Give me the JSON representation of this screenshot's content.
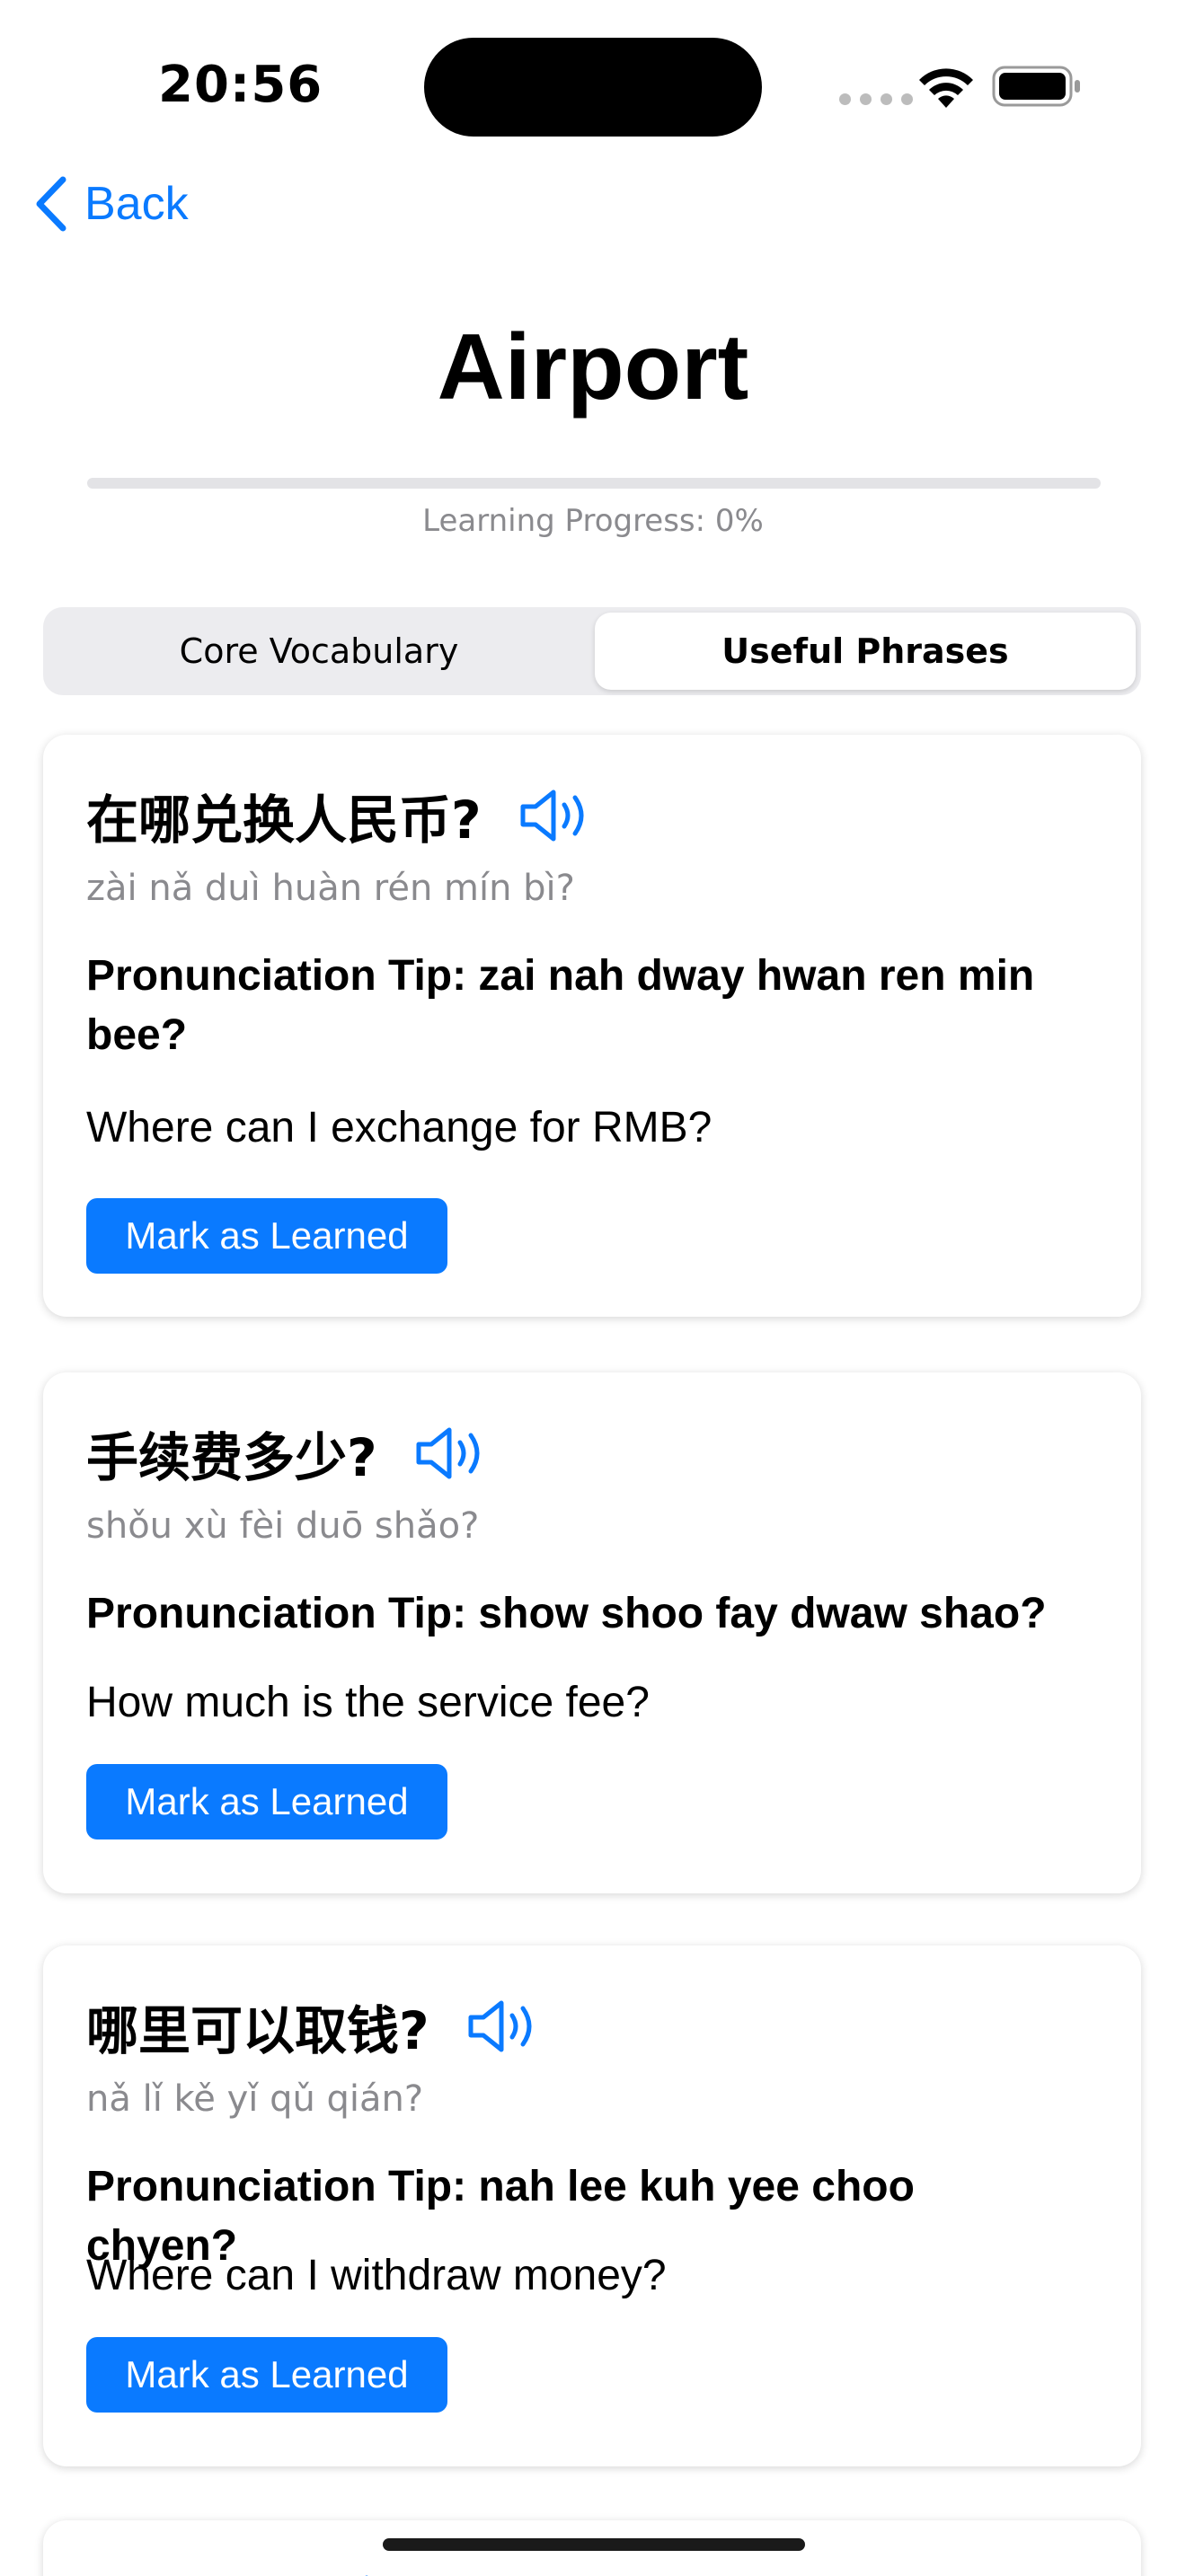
{
  "status_bar": {
    "time": "20:56"
  },
  "nav": {
    "back_label": "Back"
  },
  "page": {
    "title": "Airport",
    "progress_label": "Learning Progress: 0%",
    "progress_percent": 0
  },
  "tabs": [
    {
      "label": "Core Vocabulary",
      "selected": false
    },
    {
      "label": "Useful Phrases",
      "selected": true
    }
  ],
  "phrases": [
    {
      "hanzi": "在哪兑换人民币?",
      "pinyin": "zài nǎ duì huàn rén mín bì?",
      "tip": "Pronunciation Tip: zai nah dway hwan ren min bee?",
      "meaning": "Where can I exchange for RMB?",
      "button": "Mark as Learned"
    },
    {
      "hanzi": "手续费多少?",
      "pinyin": "shǒu xù fèi duō shǎo?",
      "tip": "Pronunciation Tip: show shoo fay dwaw shao?",
      "meaning": "How much is the service fee?",
      "button": "Mark as Learned"
    },
    {
      "hanzi": "哪里可以取钱?",
      "pinyin": "nǎ lǐ kě yǐ qǔ qián?",
      "tip": "Pronunciation Tip: nah lee kuh yee choo chyen?",
      "meaning": "Where can I withdraw money?",
      "button": "Mark as Learned"
    },
    {
      "hanzi": "帮我注册"
    }
  ],
  "colors": {
    "accent": "#0a7aff",
    "secondary_text": "#8a8a8e",
    "track": "#e3e3e6"
  }
}
